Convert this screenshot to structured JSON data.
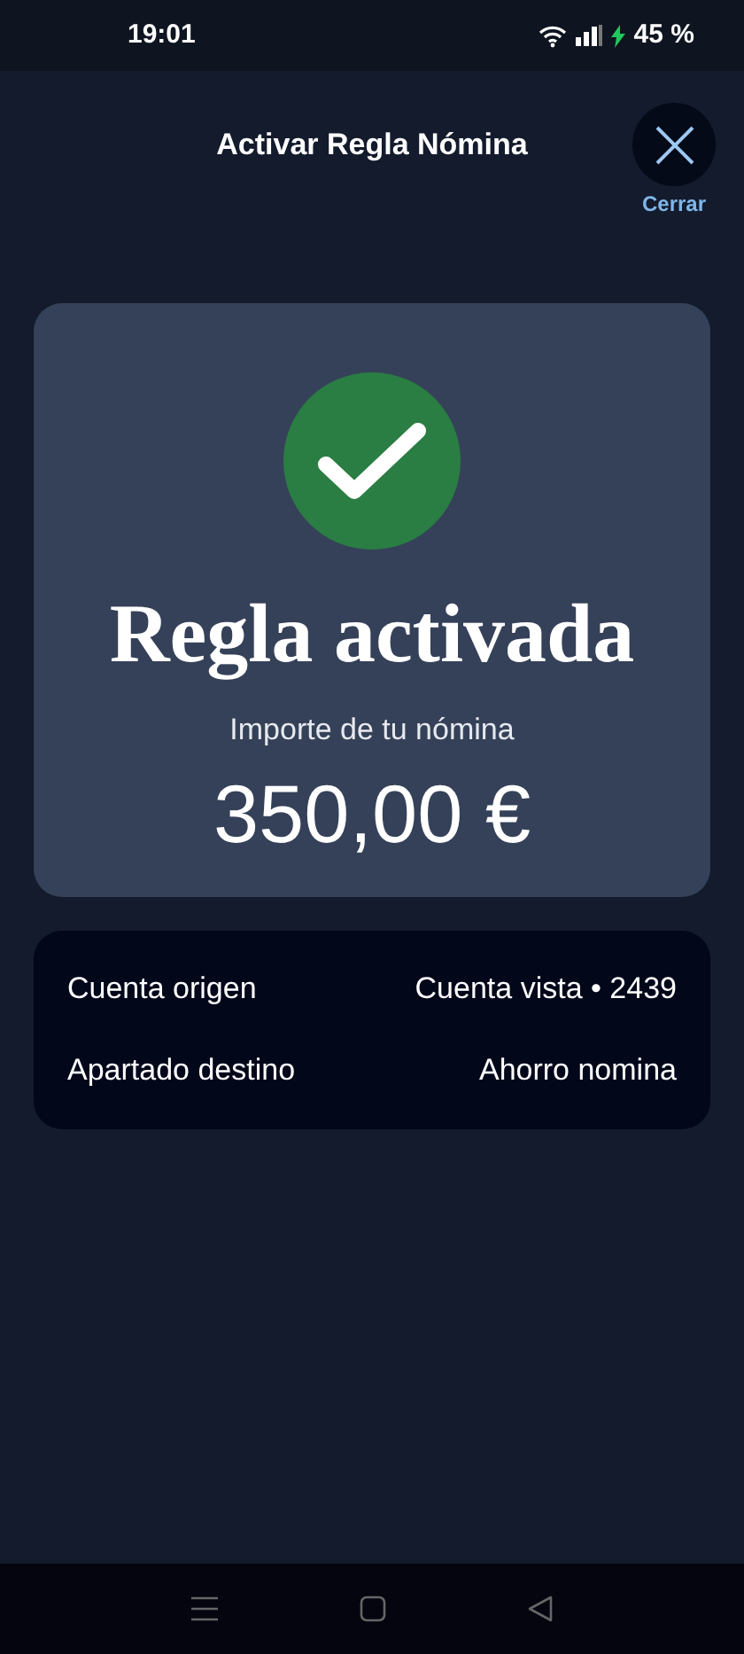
{
  "status_bar": {
    "time": "19:01",
    "battery": "45 %"
  },
  "header": {
    "title": "Activar Regla Nómina",
    "close_label": "Cerrar"
  },
  "result": {
    "title": "Regla activada",
    "subtitle": "Importe de tu nómina",
    "amount": "350,00 €"
  },
  "details": [
    {
      "label": "Cuenta origen",
      "value": "Cuenta vista • 2439"
    },
    {
      "label": "Apartado destino",
      "value": "Ahorro nomina"
    }
  ]
}
